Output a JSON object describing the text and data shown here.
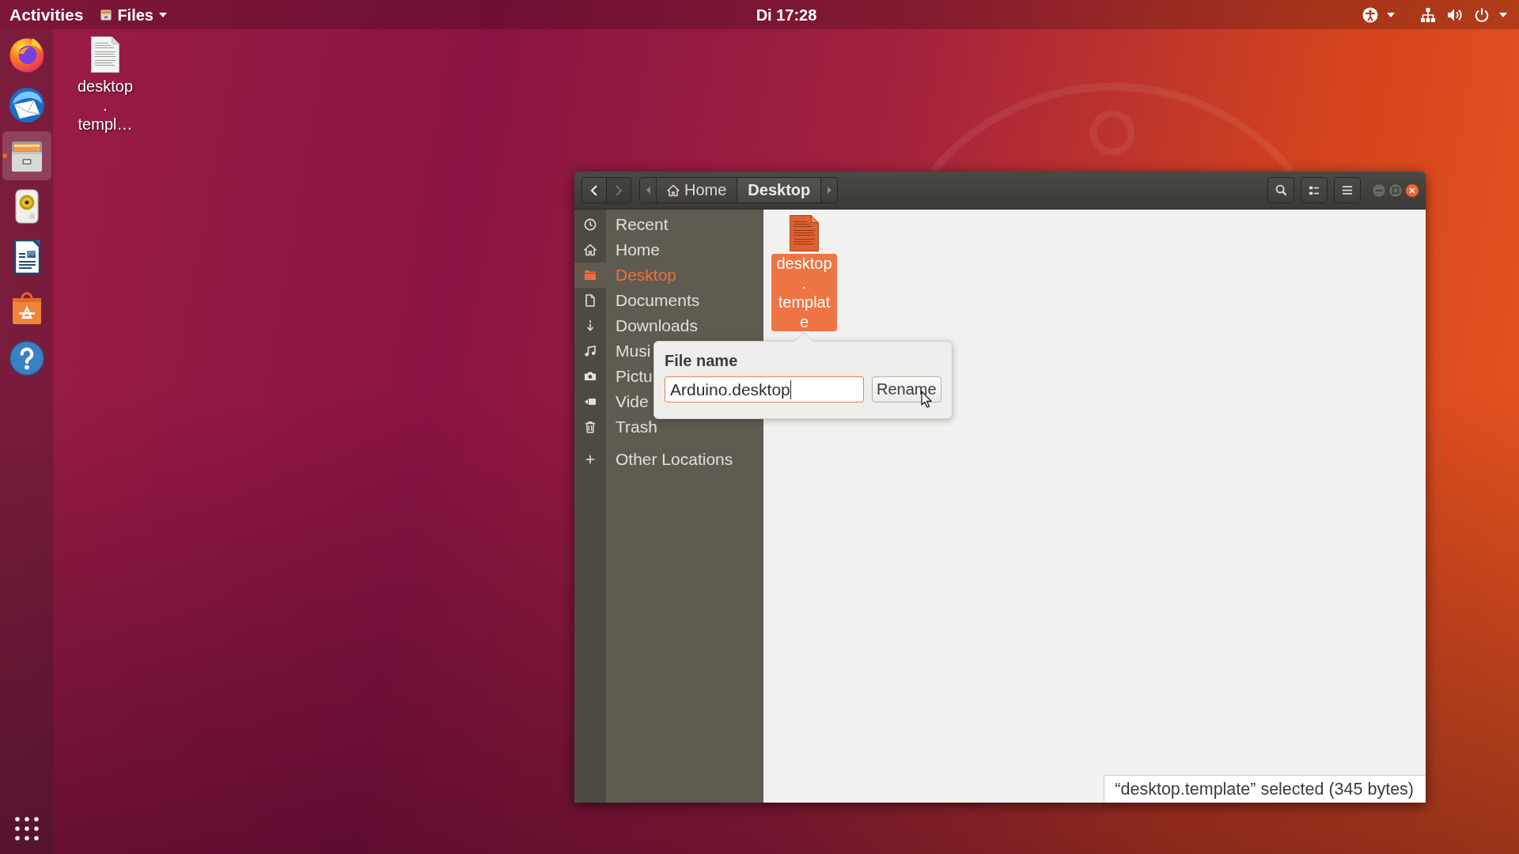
{
  "top_bar": {
    "activities": "Activities",
    "app_menu": "Files",
    "clock": "Di 17:28"
  },
  "dock": [
    {
      "kind": "browser",
      "selected": false,
      "running": false
    },
    {
      "kind": "mail",
      "selected": false,
      "running": false
    },
    {
      "kind": "files",
      "selected": true,
      "running": true
    },
    {
      "kind": "music",
      "selected": false,
      "running": false
    },
    {
      "kind": "writer",
      "selected": false,
      "running": false
    },
    {
      "kind": "store",
      "selected": false,
      "running": false
    },
    {
      "kind": "help",
      "selected": false,
      "running": false
    }
  ],
  "desktop": {
    "icons": [
      {
        "label": "desktop\n.\ntempl…"
      }
    ]
  },
  "window": {
    "nav": [
      {
        "kind": "back",
        "disabled": false
      },
      {
        "kind": "forward",
        "disabled": true
      }
    ],
    "path": [
      {
        "label": "Home",
        "kind": "home",
        "selected": false
      },
      {
        "label": "Desktop",
        "kind": "folder",
        "selected": true
      }
    ],
    "sidebar": {
      "places": [
        {
          "label": "Recent",
          "kind": "recent",
          "selected": false
        },
        {
          "label": "Home",
          "kind": "home",
          "selected": false
        },
        {
          "label": "Desktop",
          "kind": "desktop",
          "selected": true
        },
        {
          "label": "Documents",
          "kind": "documents",
          "selected": false
        },
        {
          "label": "Downloads",
          "kind": "downloads",
          "selected": false
        },
        {
          "label": "Musi",
          "kind": "music",
          "selected": false
        },
        {
          "label": "Pictu",
          "kind": "pictures",
          "selected": false
        },
        {
          "label": "Vide",
          "kind": "videos",
          "selected": false
        },
        {
          "label": "Trash",
          "kind": "trash",
          "selected": false
        }
      ],
      "other": [
        {
          "label": "Other Locations",
          "kind": "other",
          "selected": false
        }
      ]
    },
    "files": [
      {
        "label": "desktop\n.\ntemplat\ne",
        "selected": true
      }
    ],
    "rename_popover": {
      "title": "File name",
      "value": "Arduino.desktop",
      "button": "Rename"
    },
    "status": "“desktop.template” selected (345 bytes)"
  }
}
